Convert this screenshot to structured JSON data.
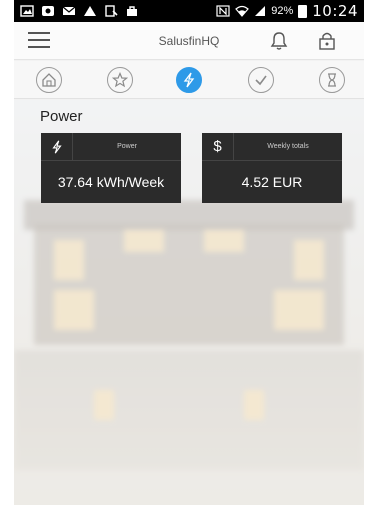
{
  "status_bar": {
    "signal_percent": "92%",
    "time": "10:24"
  },
  "app_bar": {
    "title": "SalusfinHQ"
  },
  "tabs": [
    {
      "name": "home",
      "icon": "home-icon",
      "active": false
    },
    {
      "name": "favorites",
      "icon": "star-icon",
      "active": false
    },
    {
      "name": "power",
      "icon": "lightning-icon",
      "active": true
    },
    {
      "name": "check",
      "icon": "checkmark-icon",
      "active": false
    },
    {
      "name": "timer",
      "icon": "hourglass-icon",
      "active": false
    }
  ],
  "main": {
    "section_title": "Power",
    "cards": [
      {
        "icon": "lightning-icon",
        "label": "Power",
        "value": "37.64 kWh/Week"
      },
      {
        "icon": "dollar-icon",
        "icon_glyph": "$",
        "label": "Weekly totals",
        "value": "4.52 EUR"
      }
    ]
  },
  "colors": {
    "accent": "#2e9ae8",
    "card_bg": "#2b2b2b"
  }
}
